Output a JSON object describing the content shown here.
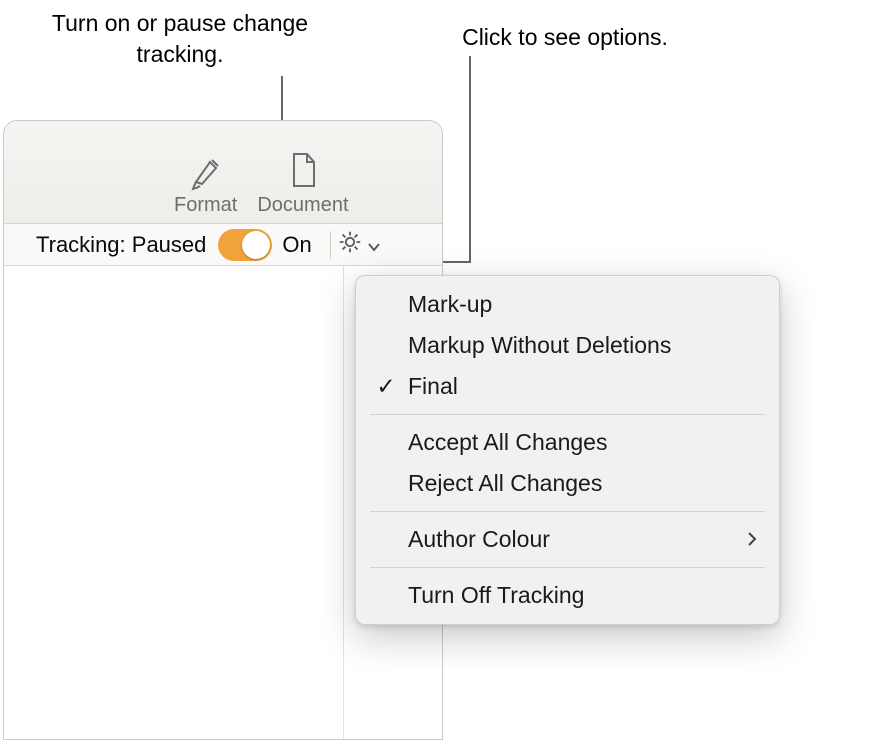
{
  "callouts": {
    "left": "Turn on or pause change tracking.",
    "right": "Click to see options."
  },
  "toolbar": {
    "format_label": "Format",
    "document_label": "Document"
  },
  "tracking": {
    "label": "Tracking: Paused",
    "on_label": "On",
    "toggle_state": "on",
    "accent_color": "#f2a23a"
  },
  "menu": {
    "items": [
      {
        "label": "Mark-up",
        "checked": false
      },
      {
        "label": "Markup Without Deletions",
        "checked": false
      },
      {
        "label": "Final",
        "checked": true
      }
    ],
    "group2": [
      {
        "label": "Accept All Changes"
      },
      {
        "label": "Reject All Changes"
      }
    ],
    "group3": [
      {
        "label": "Author Colour",
        "submenu": true
      }
    ],
    "group4": [
      {
        "label": "Turn Off Tracking"
      }
    ]
  }
}
